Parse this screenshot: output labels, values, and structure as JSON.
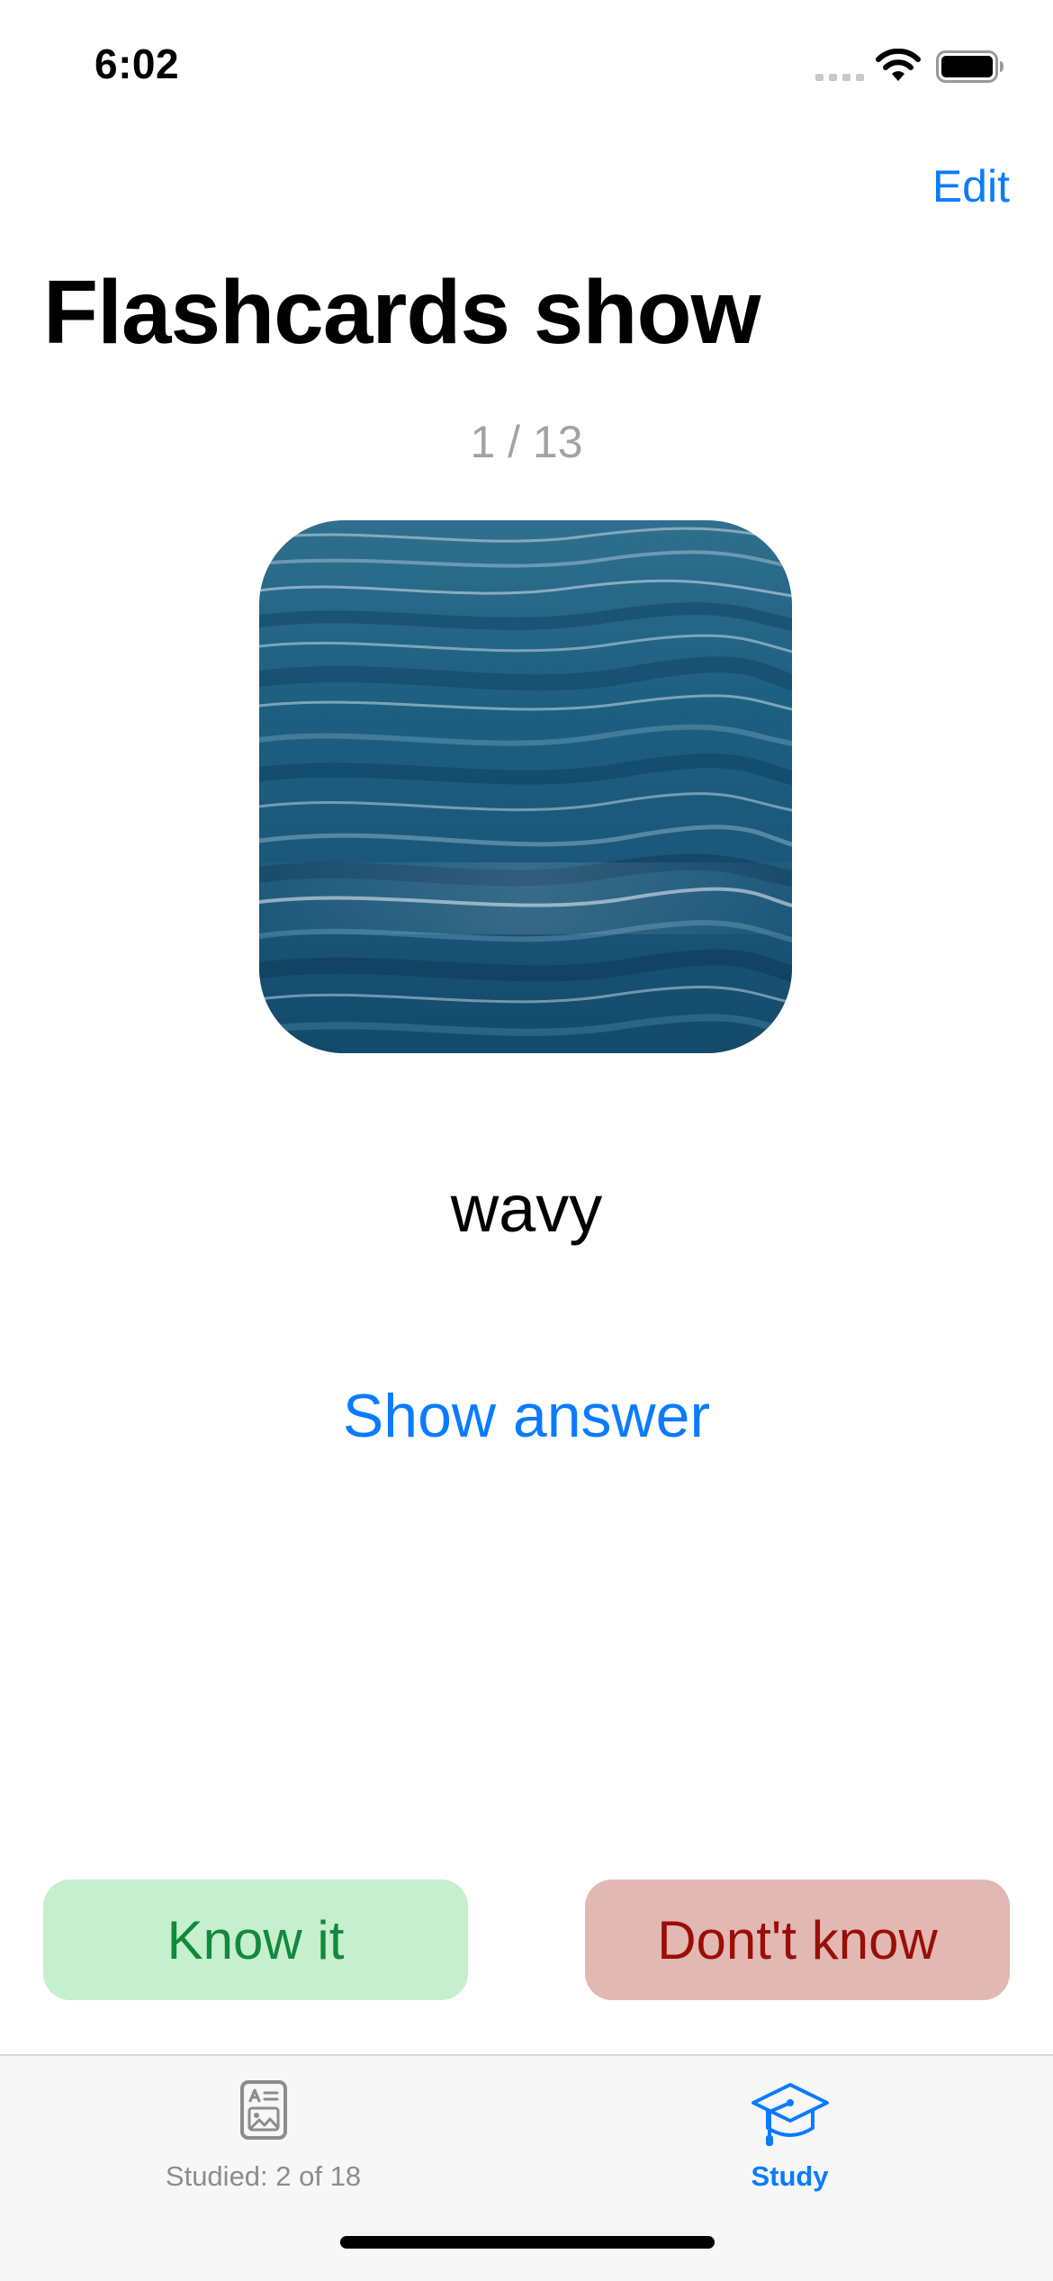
{
  "status_bar": {
    "time": "6:02",
    "icons": [
      "signal-icon",
      "wifi-icon",
      "battery-icon"
    ]
  },
  "nav": {
    "edit_label": "Edit"
  },
  "page": {
    "title": "Flashcards show",
    "counter": "1 / 13"
  },
  "card": {
    "image_icon": "ocean-waves-photo",
    "word": "wavy",
    "show_answer_label": "Show answer"
  },
  "actions": {
    "know_label": "Know it",
    "dont_know_label": "Dont't know"
  },
  "tabs": [
    {
      "label": "Studied: 2 of 18",
      "icon": "flashcard-icon",
      "selected": false
    },
    {
      "label": "Study",
      "icon": "graduation-cap-icon",
      "selected": true
    }
  ],
  "colors": {
    "accent": "#0a7bff",
    "know_bg": "#c6efcd",
    "know_text": "#118a3b",
    "dont_know_bg": "#e2b8b3",
    "dont_know_text": "#9a0e07",
    "counter_text": "#a3a3a3",
    "tab_inactive": "#8c8c8f",
    "tab_bar_bg": "#f7f7f7"
  }
}
